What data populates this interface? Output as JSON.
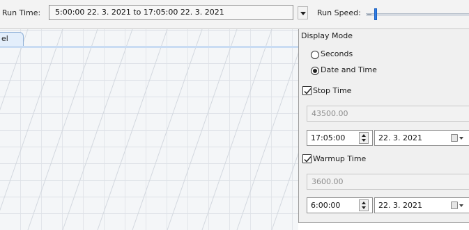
{
  "toolbar": {
    "run_time_label": "Run Time:",
    "run_time_value": "5:00:00  22. 3. 2021   to   17:05:00  22. 3. 2021",
    "run_speed_label": "Run Speed:",
    "run_speed_level": 0.1
  },
  "tab": {
    "label": "el"
  },
  "panel": {
    "title": "Display Mode",
    "mode_options": [
      {
        "label": "Seconds",
        "selected": false
      },
      {
        "label": "Date and Time",
        "selected": true
      }
    ],
    "stop_time": {
      "label": "Stop Time",
      "checked": true,
      "seconds": "43500.00",
      "time": "17:05:00",
      "date": "22.  3. 2021"
    },
    "warmup_time": {
      "label": "Warmup Time",
      "checked": true,
      "seconds": "3600.00",
      "time": "6:00:00",
      "date": "22.  3. 2021"
    }
  },
  "icons": [
    "dropdown-arrow-icon",
    "spinner-icon",
    "calendar-icon",
    "checkmark-icon"
  ],
  "colors": {
    "slider_thumb": "#2f7fe8",
    "tab_bg": "#e3eefb"
  }
}
